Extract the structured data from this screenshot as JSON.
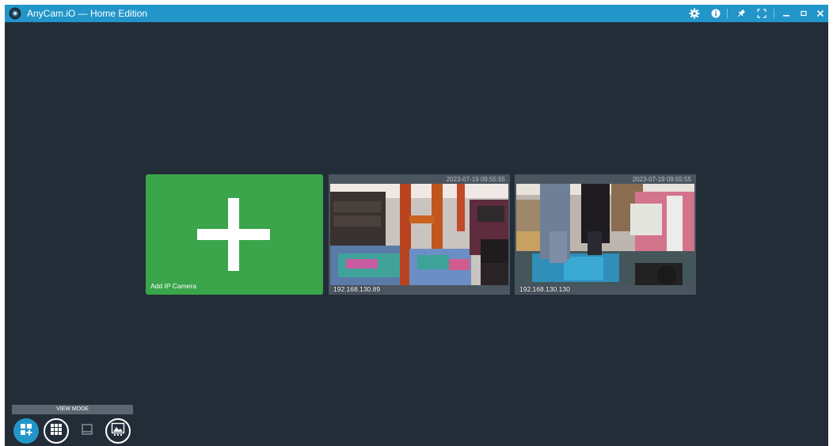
{
  "window": {
    "title": "AnyCam.iO — Home Edition",
    "colors": {
      "titlebar": "#2295c9",
      "background": "#232d38",
      "add_tile": "#3aa54a",
      "cam_frame": "#4a5560"
    }
  },
  "titlebar": {
    "icons": [
      "anycam-logo-icon",
      "settings-gear-icon",
      "info-icon",
      "pin-icon",
      "fullscreen-icon",
      "minimize-icon",
      "maximize-icon",
      "close-icon"
    ]
  },
  "tiles": {
    "add_label": "Add IP Camera",
    "cameras": [
      {
        "ip": "192.168.130.89",
        "timestamp": "2023-07-19 09:55:55"
      },
      {
        "ip": "192.168.130.130",
        "timestamp": "2023-07-19 09:55:55"
      }
    ]
  },
  "view_mode": {
    "label": "VIEW MODE",
    "buttons": [
      "grid-add-icon",
      "grid-dots-icon",
      "single-view-icon",
      "image-view-icon"
    ],
    "active_index": 0
  }
}
